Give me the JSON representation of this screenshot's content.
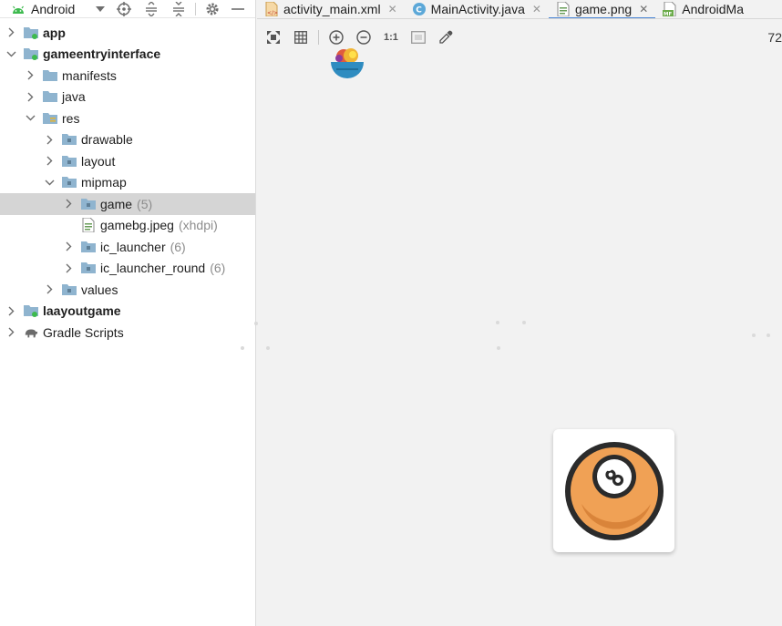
{
  "project_panel": {
    "view_selector": "Android",
    "toolbar_icons": [
      "target-icon",
      "expand-all-icon",
      "collapse-all-icon",
      "gear-icon",
      "minimize-icon"
    ],
    "tree": [
      {
        "label": "app",
        "bold": true,
        "expanded": false,
        "icon": "module-folder-icon",
        "depth": 0
      },
      {
        "label": "gameentryinterface",
        "bold": true,
        "expanded": true,
        "icon": "module-folder-icon",
        "depth": 0
      },
      {
        "label": "manifests",
        "expanded": false,
        "icon": "folder-icon",
        "depth": 1
      },
      {
        "label": "java",
        "expanded": false,
        "icon": "folder-icon",
        "depth": 1
      },
      {
        "label": "res",
        "expanded": true,
        "icon": "res-folder-icon",
        "depth": 1
      },
      {
        "label": "drawable",
        "expanded": false,
        "icon": "folder-icon",
        "depth": 2
      },
      {
        "label": "layout",
        "expanded": false,
        "icon": "folder-icon",
        "depth": 2
      },
      {
        "label": "mipmap",
        "expanded": true,
        "icon": "folder-icon",
        "depth": 2
      },
      {
        "label": "game",
        "hint": "(5)",
        "expanded": false,
        "icon": "folder-icon",
        "depth": 3,
        "selected": true
      },
      {
        "label": "gamebg.jpeg",
        "hint": "(xhdpi)",
        "icon": "image-file-icon",
        "depth": 3,
        "leaf": true
      },
      {
        "label": "ic_launcher",
        "hint": "(6)",
        "expanded": false,
        "icon": "folder-icon",
        "depth": 3
      },
      {
        "label": "ic_launcher_round",
        "hint": "(6)",
        "expanded": false,
        "icon": "folder-icon",
        "depth": 3
      },
      {
        "label": "values",
        "expanded": false,
        "icon": "folder-icon",
        "depth": 2
      },
      {
        "label": "laayoutgame",
        "bold": true,
        "expanded": false,
        "icon": "module-folder-icon",
        "depth": 0
      },
      {
        "label": "Gradle Scripts",
        "expanded": false,
        "icon": "gradle-icon",
        "depth": 0
      }
    ]
  },
  "tabs": [
    {
      "label": "activity_main.xml",
      "icon": "xml-file-icon",
      "active": false
    },
    {
      "label": "MainActivity.java",
      "icon": "java-class-icon",
      "active": false
    },
    {
      "label": "game.png",
      "icon": "image-file-icon",
      "active": true
    },
    {
      "label": "AndroidMa",
      "icon": "manifest-file-icon",
      "active": false
    }
  ],
  "image_editor": {
    "toolbar_icons": [
      "fit-screen-icon",
      "grid-icon",
      "zoom-in-icon",
      "zoom-out-icon",
      "actual-size-icon",
      "background-icon",
      "color-picker-icon"
    ],
    "actual_size_label": "1:1",
    "zoom_level": "72"
  },
  "colors": {
    "accent": "#4a86d6",
    "folder": "#8fb4cf",
    "module_dot": "#3dba4e",
    "ball_orange": "#f0a155",
    "ball_dark": "#2b2b2b"
  }
}
